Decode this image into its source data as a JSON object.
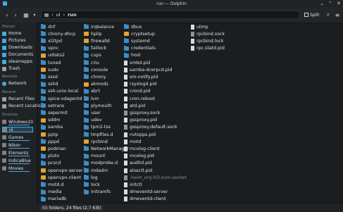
{
  "window": {
    "title": "run — Dolphin"
  },
  "toolbar": {
    "breadcrumb": [
      "ul",
      "run"
    ],
    "split_label": "Split"
  },
  "sidebar": {
    "places_header": "Places",
    "places": [
      "Home",
      "Pictures",
      "Downloads",
      "Documents",
      "steamapps",
      "Trash"
    ],
    "remote_header": "Remote",
    "remote": [
      "Network"
    ],
    "recent_header": "Recent",
    "recent": [
      "Recent Files",
      "Recent Locations"
    ],
    "devices_header": "Devices",
    "devices": [
      "Windows10",
      "ul",
      "Games",
      "Nikon",
      "Elements",
      "IndicaBlue",
      "Movies"
    ]
  },
  "columns": [
    [
      "dnf",
      "chrony-dhcp",
      "xl2tpd",
      "vpnc",
      "udisks2",
      "tuned",
      "sudo",
      "sssd",
      "sshd",
      "ssh-unix-local",
      "spice-vdagentd",
      "setrans",
      "sepermit",
      "sddm",
      "samba",
      "pptp",
      "pppd",
      "podman",
      "pluto",
      "pcscd",
      "openvpn-server",
      "openvpn-client",
      "motd.d",
      "media",
      "mariadb"
    ],
    [
      "irqbalance",
      "hplip",
      "firewalld",
      "faillock",
      "cups",
      "criu",
      "console",
      "chrony",
      "akmods",
      "abrt",
      "lvm",
      "plymouth",
      "user",
      "udev",
      "tpm2-tss",
      "tmpfiles.d",
      "rpcbind",
      "NetworkManager",
      "mount",
      "modprobe.d",
      "mdadm",
      "log",
      "lock",
      "initramfs"
    ],
    [
      "dbus",
      "cryptsetup",
      "systemd",
      "credentials",
      "host",
      "smbd.pid",
      "samba-dcerpcd.pid",
      "sm-notify.pid",
      "rsyslogd.pid",
      "crond.pid",
      "cron.reboot",
      "atd.pid",
      "gssproxy.sock",
      "gssproxy.pid",
      "gssproxy.default.sock",
      "nvtopps.pid",
      "motd",
      "mcelog-client",
      "mcelog.pid",
      "auditd.pid",
      "alsactl.pid",
      ".heim_org.h5l.kcm-socket",
      "initctl",
      "dmeventd-server",
      "dmeventd-client"
    ],
    [
      "utmp",
      "rpcbind.sock",
      "rpcbind.lock",
      "rpc.statd.pid"
    ]
  ],
  "status": {
    "summary": "55 folders, 24 files (2.7 KiB)"
  }
}
